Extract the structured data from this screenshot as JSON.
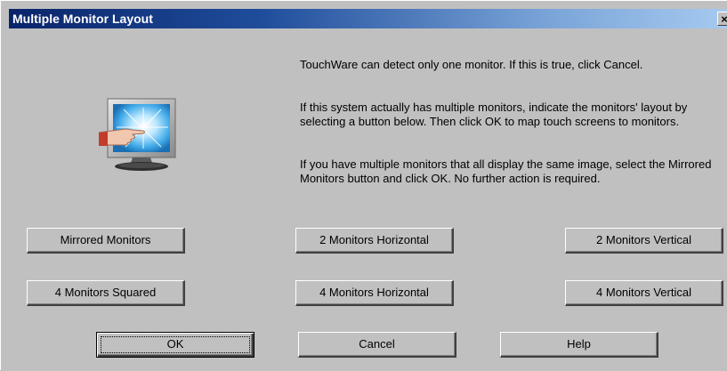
{
  "window": {
    "title": "Multiple Monitor Layout",
    "close_symbol": "×"
  },
  "messages": {
    "line1": "TouchWare can detect only one monitor. If this is true, click Cancel.",
    "line2": "If this system actually has multiple monitors, indicate the monitors' layout by selecting a button below. Then click OK to map touch screens to monitors.",
    "line3": "If you have multiple monitors that all display the same image, select the Mirrored Monitors button and click OK. No further action is required."
  },
  "layout_buttons": {
    "mirrored": "Mirrored Monitors",
    "two_horizontal": "2 Monitors Horizontal",
    "two_vertical": "2 Monitors Vertical",
    "four_squared": "4 Monitors Squared",
    "four_horizontal": "4 Monitors Horizontal",
    "four_vertical": "4 Monitors  Vertical"
  },
  "dialog_buttons": {
    "ok": "OK",
    "cancel": "Cancel",
    "help": "Help"
  },
  "icon": {
    "name": "touch-monitor-icon"
  },
  "colors": {
    "titlebar_start": "#0a246a",
    "titlebar_end": "#a6caf0",
    "dialog_bg": "#c0c0c0"
  }
}
